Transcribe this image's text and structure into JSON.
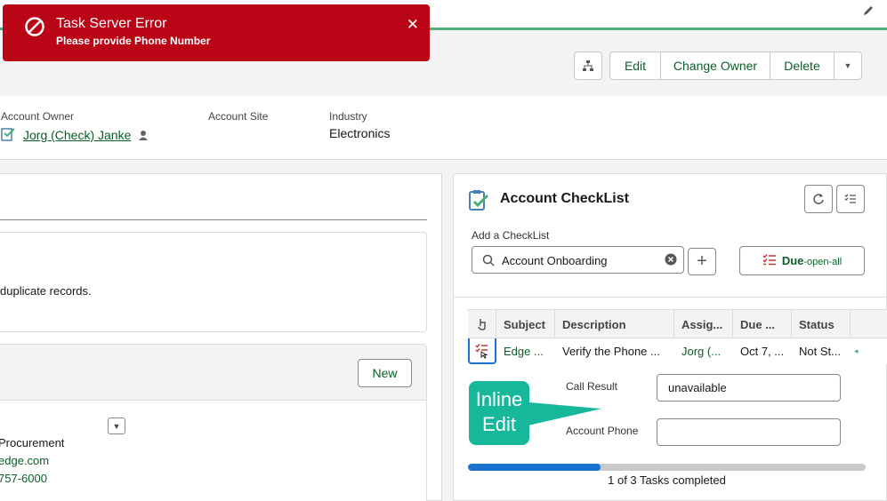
{
  "toast": {
    "title": "Task Server Error",
    "message": "Please provide Phone Number",
    "close_symbol": "✕",
    "color": "#ba0517"
  },
  "header": {
    "actions": [
      "Edit",
      "Change Owner",
      "Delete"
    ],
    "more_symbol": "▼",
    "fields": {
      "owner_label": "Account Owner",
      "owner_value": "Jorg (Check) Janke",
      "site_label": "Account Site",
      "industry_label": "Industry",
      "industry_value": "Electronics"
    }
  },
  "left_panel": {
    "notice_text": "duplicate records.",
    "new_button": "New",
    "contact": {
      "title": "Procurement",
      "email": "edge.com",
      "phone": "757-6000"
    }
  },
  "checklist": {
    "title": "Account CheckList",
    "add_label": "Add a CheckList",
    "search_value": "Account Onboarding",
    "plus_symbol": "+",
    "due_main": "Due",
    "due_sub": "-open-all",
    "columns": [
      "Subject",
      "Description",
      "Assig...",
      "Due ...",
      "Status"
    ],
    "row": {
      "subject": "Edge ...",
      "description": "Verify the Phone ...",
      "assigned": "Jorg (...",
      "due": "Oct 7, ...",
      "status": "Not St..."
    },
    "callout": "Inline Edit",
    "fields": [
      {
        "label": "Call Result",
        "value": "unavailable"
      },
      {
        "label": "Account Phone",
        "value": ""
      }
    ],
    "progress": {
      "completed": 1,
      "total": 3,
      "text": "1 of 3 Tasks completed"
    },
    "accent_color": "#0b5d2a"
  }
}
